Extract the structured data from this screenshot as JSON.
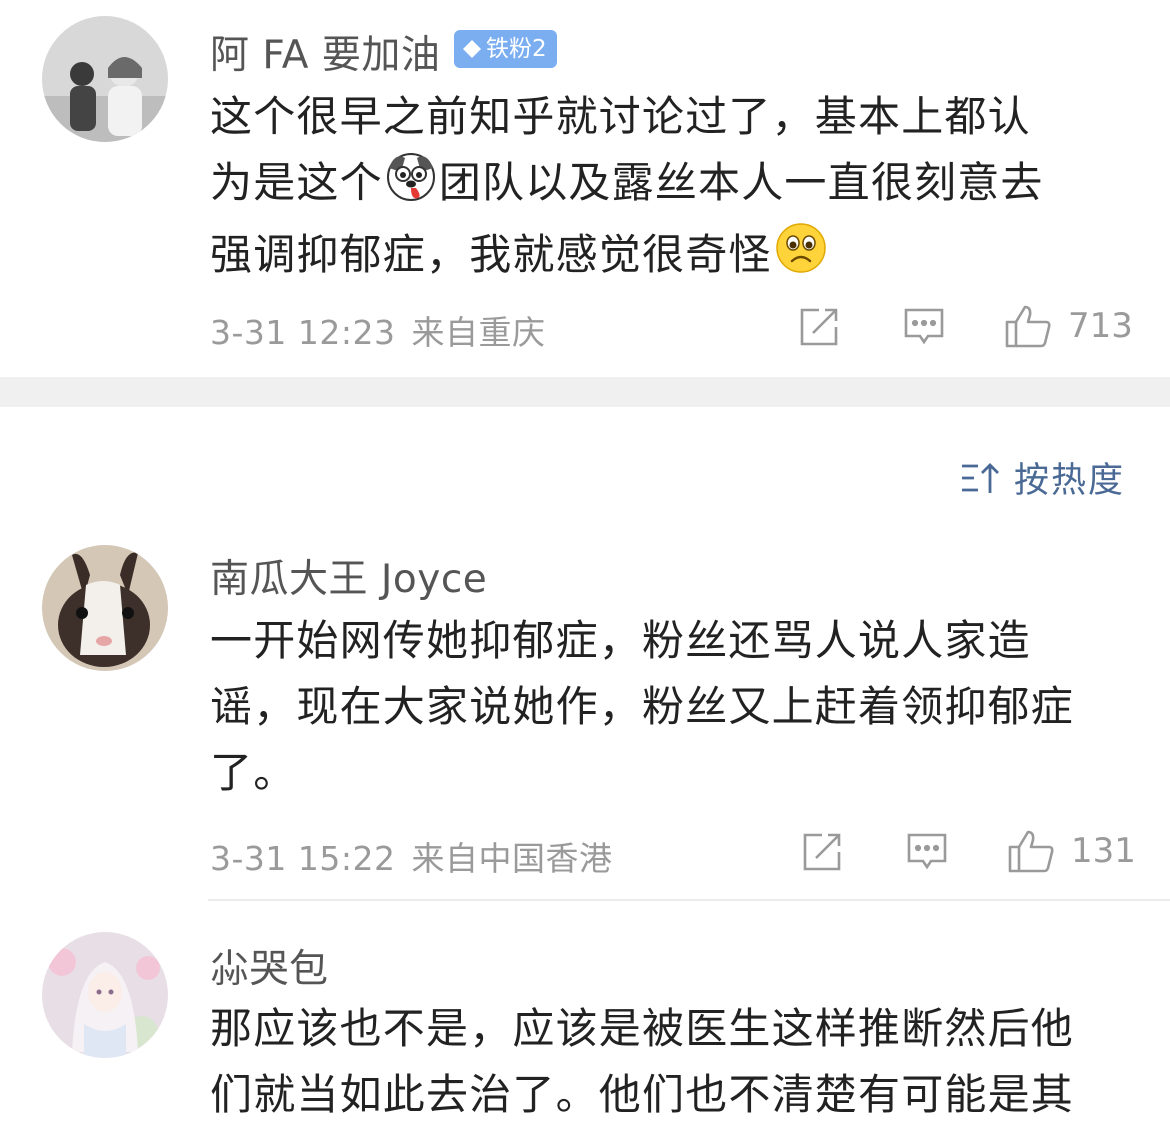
{
  "comments": [
    {
      "username": "阿 FA 要加油",
      "badge": "铁粉2",
      "text_lines": [
        "这个很早之前知乎就讨论过了，基本上都认",
        "为是这个",
        "团队以及露丝本人一直很刻意去",
        "强调抑郁症，我就感觉很奇怪"
      ],
      "time": "3-31 12:23",
      "location": "来自重庆",
      "likes": "713"
    },
    {
      "username": "南瓜大王 Joyce",
      "text_lines": [
        "一开始网传她抑郁症，粉丝还骂人说人家造",
        "谣，现在大家说她作，粉丝又上赶着领抑郁症",
        "了。"
      ],
      "time": "3-31 15:22",
      "location": "来自中国香港",
      "likes": "131"
    },
    {
      "username": "尛哭包",
      "text_lines": [
        "那应该也不是，应该是被医生这样推断然后他",
        "们就当如此去治了。他们也不清楚有可能是其"
      ]
    }
  ],
  "sort": {
    "label": "按热度",
    "icon": "sort-icon"
  },
  "icons": {
    "share": "share-icon",
    "reply": "comment-icon",
    "like": "thumbs-up-icon",
    "dog_emoji": "dog-emoji-icon",
    "sad_emoji": "sad-face-icon",
    "badge_gem": "diamond-icon"
  },
  "colors": {
    "badge_bg": "#7aaef0",
    "sort_text": "#4a6a95",
    "meta_text": "#9a9a9a"
  }
}
